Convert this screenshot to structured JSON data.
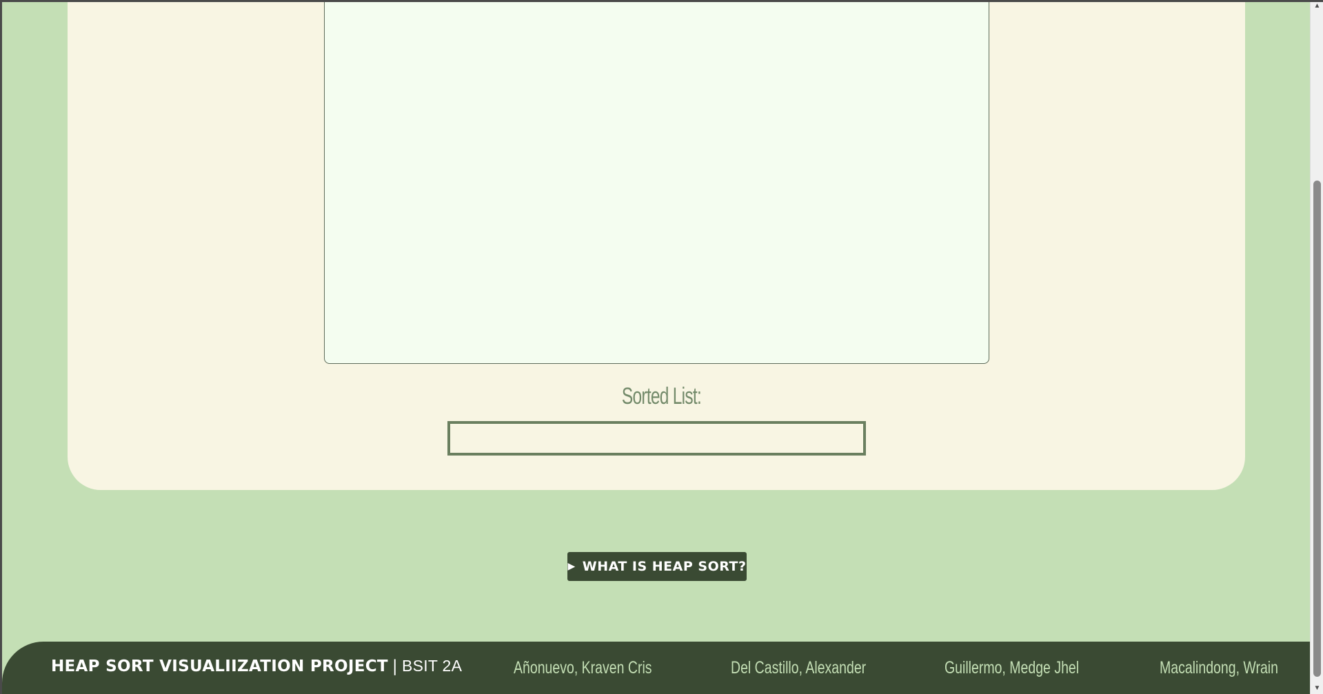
{
  "sorted_section": {
    "label": "Sorted List:",
    "value": ""
  },
  "help_button": {
    "label": "WHAT IS HEAP SORT?",
    "icon": "play-triangle-icon"
  },
  "footer": {
    "project_title": "HEAP SORT VISUALIIZATION PROJECT",
    "separator": "|",
    "section": "BSIT 2A",
    "members": [
      "Añonuevo, Kraven Cris",
      "Del Castillo, Alexander",
      "Guillermo, Medge Jhel",
      "Macalindong, Wrain"
    ]
  },
  "colors": {
    "page_background": "#c4dfb5",
    "card_background": "#f8f5e3",
    "canvas_background": "#f4fdf0",
    "accent_dark": "#3a4a33",
    "label_green": "#738a6a"
  }
}
